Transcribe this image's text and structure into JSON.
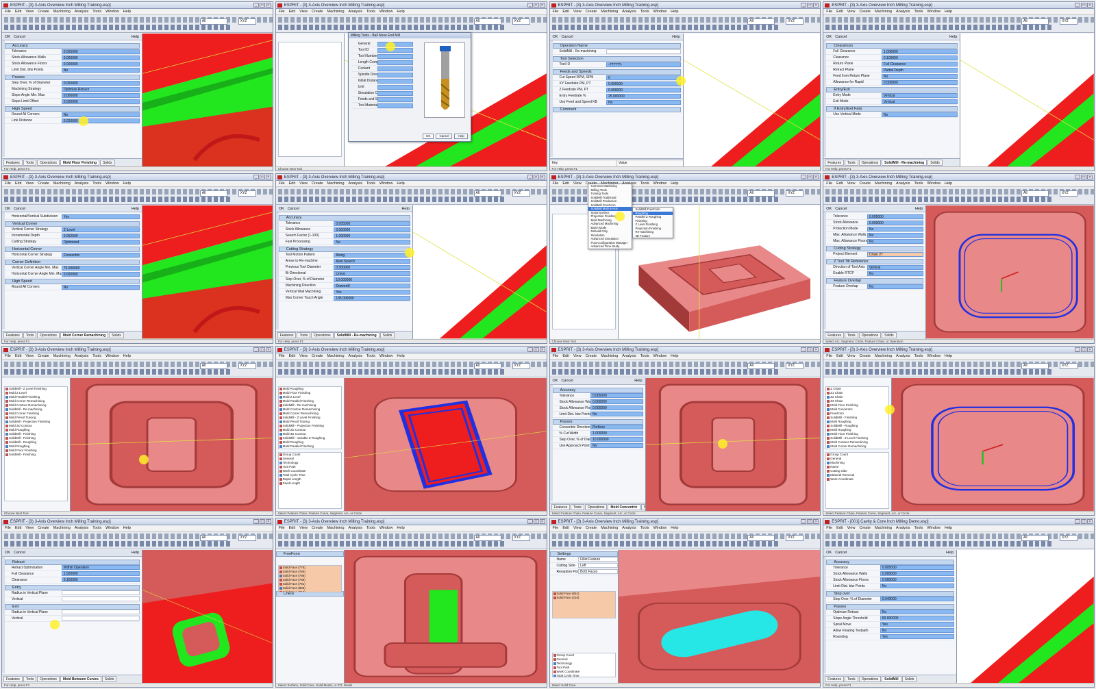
{
  "colors": {
    "red": "#ee1e1e",
    "green": "#22e61e",
    "stock": "#d55a5a",
    "stock_dark": "#a33a3a",
    "stock_light": "#e98888",
    "toolpath": "#2030e0",
    "cyan": "#27e6e6",
    "highlight": "#fff02a"
  },
  "window": {
    "title_3axis": "ESPRIT - [3) 3-Axis Overview Inch Milling Training.esp]",
    "title_cavity": "ESPRIT - [001] Cavity & Core Inch Milling Demo.esp]",
    "menu": [
      "File",
      "Edit",
      "View",
      "Create",
      "Machining",
      "Analysis",
      "Tools",
      "Window",
      "Help"
    ],
    "layer_combo": "All",
    "view_combo": "XYZ"
  },
  "panel": {
    "ok": "OK",
    "cancel": "Cancel",
    "help": "Help"
  },
  "tabs": {
    "features": "Features",
    "tools": "Tools",
    "operations": "Operations",
    "solids": "Solids"
  },
  "kv": {
    "key": "Key",
    "value": "Value"
  },
  "status": {
    "choose_next": "Choose Next Tool",
    "for_help": "For Help, press F1",
    "coords": "SOLIDMILL SUB-ELEMENTS SNAP",
    "select_arc": "Select Arc, Segment, Circle, Feature Chain, or Operation",
    "select_feature": "Select Feature Chain, Feature Curve, Segment, Arc, or Circle",
    "select_surface": "Select Surface, Solid Face, Solid Model, or STL Model",
    "select_solid_face": "Select Solid Face"
  },
  "tiles": [
    {
      "title": "3axis",
      "panel_tab": "Mold Floor Finishing",
      "groups": [
        {
          "name": "Accuracy",
          "rows": [
            [
              "Tolerance",
              "0.005000"
            ],
            [
              "Stock Allowance Walls",
              "0.000000"
            ],
            [
              "Stock Allowance Floors",
              "0.000000"
            ],
            [
              "Limit Dist. btw Points",
              "No"
            ]
          ]
        },
        {
          "name": "Passes",
          "rows": [
            [
              "Step Over, % of Diameter",
              "0.050000"
            ],
            [
              "Machining Strategy",
              "Optimize Retract"
            ],
            [
              "Slope Angle Min. Max",
              "0.000000"
            ],
            [
              "Slope Limit Offset",
              "0.000000"
            ]
          ]
        },
        {
          "name": "High Speed",
          "rows": [
            [
              "Round All Corners",
              "No"
            ],
            [
              "Link Distance",
              "0.000000"
            ]
          ]
        }
      ]
    },
    {
      "title": "3axis",
      "dialog_title": "Milling Tools - Ball Nose End Mill",
      "dialog_rows": [
        "General",
        "Tool ID",
        "Tool Number",
        "Length Comp Register",
        "Coolant",
        "Spindle Direction",
        "Initial Distance",
        "Unit",
        "Simulation Cut Color",
        "Feeds and Speeds",
        "Tool Material"
      ],
      "dialog_buttons": [
        "OK",
        "Cancel",
        "Help"
      ]
    },
    {
      "title": "3axis",
      "panel_tab": "SolidMill - Re-machining",
      "groups": [
        {
          "name": "Operation Name",
          "rows": [
            [
              "SolidMill - Re-machining",
              ""
            ]
          ]
        },
        {
          "name": "Tool Selection",
          "rows": [
            [
              "Tool ID",
              "-??????-"
            ]
          ]
        },
        {
          "name": "Feeds and Speeds",
          "rows": [
            [
              "Cut Speed RPM, SPM",
              "0"
            ],
            [
              "XY Feedrate PM, PT",
              "0.000000"
            ],
            [
              "Z Feedrate PM, PT",
              "0.000000"
            ],
            [
              "Entry Feedrate %",
              "25.000000"
            ],
            [
              "Use Feed and Speed KB",
              "No"
            ]
          ]
        },
        {
          "name": "Comment",
          "rows": []
        }
      ]
    },
    {
      "title": "3axis",
      "panel_tab": "SolidMill - Re-machining",
      "groups": [
        {
          "name": "Clearances",
          "rows": [
            [
              "Full Clearance",
              "1.000000"
            ],
            [
              "Clearance",
              "0.100000"
            ],
            [
              "Return Plane",
              "Full Clearance"
            ],
            [
              "Retract Plane",
              "Partial Depth"
            ],
            [
              "Feed from Return Plane",
              "No"
            ],
            [
              "Allowance for Rapid",
              "0.000000"
            ]
          ]
        },
        {
          "name": "Entry/Exit",
          "rows": [
            [
              "Entry Mode",
              "Vertical"
            ],
            [
              "Exit Mode",
              "Vertical"
            ]
          ]
        },
        {
          "name": "If Entry/Exit Fails",
          "rows": [
            [
              "Use Vertical Mode",
              "No"
            ]
          ]
        }
      ]
    },
    {
      "title": "3axis",
      "panel_tab": "Mold Corner Remachining",
      "groups": [
        {
          "name": "",
          "rows": [
            [
              "Horizontal/Vertical Subdivision",
              "Yes"
            ]
          ]
        },
        {
          "name": "Vertical Corner",
          "rows": [
            [
              "Vertical Corner Strategy",
              "Z-Level"
            ],
            [
              "Incremental Depth",
              "0.062500"
            ],
            [
              "Cutting Strategy",
              "Optimized"
            ]
          ]
        },
        {
          "name": "Horizontal Corner",
          "rows": [
            [
              "Horizontal Corner Strategy",
              "Concentric"
            ]
          ]
        },
        {
          "name": "Corner Definition",
          "rows": [
            [
              "Vertical Corner Angle Min. Max",
              "75.000000"
            ],
            [
              "Horizontal Corner Angle Min. Max",
              "0.000000"
            ]
          ]
        },
        {
          "name": "High Speed",
          "rows": [
            [
              "Round All Corners",
              "No"
            ]
          ]
        }
      ]
    },
    {
      "title": "3axis",
      "panel_tab": "SolidMill - Re-machining",
      "groups": [
        {
          "name": "Accuracy",
          "rows": [
            [
              "Tolerance",
              "0.005000"
            ],
            [
              "Stock Allowance",
              "0.000000"
            ],
            [
              "Search Factor (1-100)",
              "1.000000"
            ],
            [
              "Fast Processing",
              "No"
            ]
          ]
        },
        {
          "name": "Cutting Strategy",
          "rows": [
            [
              "Tool Motion Pattern",
              "Along"
            ],
            [
              "Areas to Re-machine",
              "Auto Search"
            ],
            [
              "Previous Tool Diameter",
              "0.500000"
            ],
            [
              "Bi-Directional",
              "Linear"
            ],
            [
              "Step Over, % of Diameter",
              "10.000000"
            ],
            [
              "Machining Direction",
              "Downmill"
            ],
            [
              "Vertical Wall Machining",
              "Yes"
            ],
            [
              "Max Corner Touch Angle",
              "135.000000"
            ]
          ]
        }
      ]
    },
    {
      "title": "3axis",
      "menu1": [
        "Common Machining",
        "Milling Tools",
        "Turning Tools",
        "SolidMill Traditional",
        "SolidMill Production",
        "SolidMill FreeForm",
        "SolidMill Multi & Axis",
        "Spiral Surface",
        "Projection Finishing",
        "Mold Machining",
        "Advanced Machining",
        "Batch Mode",
        "Rebuild Only",
        "Simulation",
        "Advanced Simulation",
        "Post Configuration Manager",
        "Advanced Time Study"
      ],
      "menu2": [
        "SolidMill FreeForm",
        "Roughing",
        "Parallel Z Roughing",
        "Finishing",
        "Z Level Finishing",
        "Projection Finishing",
        "Re-machining",
        "3D Feature"
      ]
    },
    {
      "title": "3axis",
      "groups": [
        {
          "name": "",
          "rows": [
            [
              "Tolerance",
              "0.005000"
            ],
            [
              "Stock Allowance",
              "0.000000"
            ],
            [
              "Protection Mode",
              "No"
            ],
            [
              "Max. Allowance Walls",
              "No"
            ],
            [
              "Max. Allowance Floors",
              "No"
            ]
          ]
        },
        {
          "name": "Cutting Strategy",
          "rows": [
            [
              "Project Element",
              "Chain 27"
            ]
          ]
        },
        {
          "name": "Z Tool Tilt Reference",
          "rows": [
            [
              "Direction of Tool Axis",
              "Vertical"
            ],
            [
              "Enable RTCP",
              "No"
            ]
          ]
        },
        {
          "name": "Feature Overlap",
          "rows": [
            [
              "Feature Overlap",
              "No"
            ]
          ]
        }
      ]
    },
    {
      "title": "3axis",
      "tree": [
        "SolidMill - Z Level Finishing",
        "Mold Z Level",
        "Mold Parallel Finishing",
        "Mold Corner Remachining",
        "Mold Contour Remachining",
        "SolidMill - Re-machining",
        "Mold Corner Finishing",
        "Mold Pencil Tracing",
        "SolidMill - Projection Finishing",
        "Mold 2D Contour",
        "Mold Roughing",
        "SolidMill - Finishing",
        "SolidMill - Finishing",
        "SolidMill - Roughing",
        "Mold Roughing",
        "Mold Floor Finishing",
        "SolidMill - Finishing"
      ]
    },
    {
      "title": "3axis",
      "tree": [
        "Mold Roughing",
        "Mold Floor Finishing",
        "Mold Z Level",
        "Mold Parallel Finishing",
        "SolidMill - Re-machining",
        "Mold Contour Remachining",
        "Mold Corner Remachining",
        "SolidMill - Z Level Finishing",
        "Mold Pencil Tracing",
        "SolidMill - Projection Finishing",
        "Mold 2D Contour",
        "Mold 3D Contour",
        "SolidMill - Variable Z Roughing",
        "Mold Roughing",
        "Mold Parallel Finishing",
        "Mold Roughing"
      ],
      "props": [
        "Group Count",
        "General",
        "Technology",
        "Tool Path",
        "Work Coordinate",
        "Total Cycle Time",
        "Rapid Length",
        "Feed Length"
      ]
    },
    {
      "title": "3axis",
      "panel_tab": "Mold Concentric",
      "groups": [
        {
          "name": "Accuracy",
          "rows": [
            [
              "Tolerance",
              "0.005000"
            ],
            [
              "Stock Allowance Walls",
              "0.000000"
            ],
            [
              "Stock Allowance Floors",
              "0.000000"
            ],
            [
              "Limit Dist. btw Points",
              "No"
            ]
          ]
        },
        {
          "name": "Passes",
          "rows": [
            [
              "Concentric Direction",
              "Portless"
            ],
            [
              "% Cut Width",
              "1.000000"
            ]
          ]
        },
        {
          "name": "",
          "rows": [
            [
              "Step Over, % of Diameter",
              "10.000000"
            ],
            [
              "Use Approach Point",
              "No"
            ]
          ]
        }
      ]
    },
    {
      "title": "3axis",
      "tree": [
        "Z Chain",
        "Z1 Chain",
        "Z2 Chain",
        "Z3 Chain",
        "Mold Floor Finishing",
        "Mold Concentric",
        "FreeForm",
        "SolidMill - Finishing",
        "Mold Roughing",
        "SolidMill - Roughing",
        "Mold Roughing",
        "Mold Floor Finishing",
        "SolidMill - Z Level Finishing",
        "Mold Contour Remachining",
        "Mold Corner Remachining",
        "SolidMill - Finishing"
      ],
      "props": [
        "Group Count",
        "General",
        "Machining",
        "Name",
        "Cutting Side",
        "Material Removal",
        "Work Coordinate"
      ]
    },
    {
      "title": "3axis",
      "panel_tab": "Mold Between Curves",
      "groups": [
        {
          "name": "Retract",
          "rows": [
            [
              "Retract Optimization",
              "Within Operation"
            ],
            [
              "Full Clearance",
              "1.500000"
            ],
            [
              "Clearance",
              "0.100000"
            ]
          ]
        },
        {
          "name": "Entry",
          "rows": [
            [
              "Radius in Vertical Plane",
              ""
            ],
            [
              "Vertical",
              ""
            ]
          ]
        },
        {
          "name": "Exit",
          "rows": [
            [
              "Radius in Vertical Plane",
              ""
            ],
            [
              "Vertical",
              ""
            ]
          ]
        }
      ]
    },
    {
      "title": "3axis",
      "list_title": "FreeForm",
      "faces": [
        "Solid Face (775)",
        "Solid Face (780)",
        "Solid Face (786)",
        "Solid Face (789)",
        "Solid Face (791)",
        "Solid Face (806)",
        "Solid Face (810)"
      ],
      "check": "Check"
    },
    {
      "title": "3axis",
      "list_title": "Settings",
      "rows": [
        [
          "Name",
          "Fillet Feature"
        ],
        [
          "Cutting Side",
          "Left"
        ],
        [
          "Reception Point",
          "Both Faces"
        ]
      ],
      "profile": [
        "Solid Face (651)",
        "Solid Face (216)"
      ],
      "props": [
        "Group Count",
        "General",
        "Technology",
        "Tool Path",
        "Work Coordinate",
        "Total Cycle Time",
        "Rapid Length"
      ]
    },
    {
      "title": "cavity",
      "panel_tab": "SolidMill",
      "groups": [
        {
          "name": "Accuracy",
          "rows": [
            [
              "Tolerance",
              "0.005000"
            ],
            [
              "Stock Allowance Walls",
              "0.000000"
            ],
            [
              "Stock Allowance Floors",
              "0.000000"
            ],
            [
              "Limit Dist. btw Points",
              "No"
            ]
          ]
        },
        {
          "name": "Step over",
          "rows": [
            [
              "Step Over, % of Diameter",
              "0.040000"
            ]
          ]
        },
        {
          "name": "Passes",
          "rows": [
            [
              "Optimize Retract",
              "No"
            ],
            [
              "Slope Angle Threshold",
              "60.000000"
            ],
            [
              "Spiral Move",
              "Yes"
            ],
            [
              "Allow Floating Toolpath",
              "No"
            ],
            [
              "Rounding",
              "Yes"
            ]
          ]
        }
      ]
    }
  ]
}
